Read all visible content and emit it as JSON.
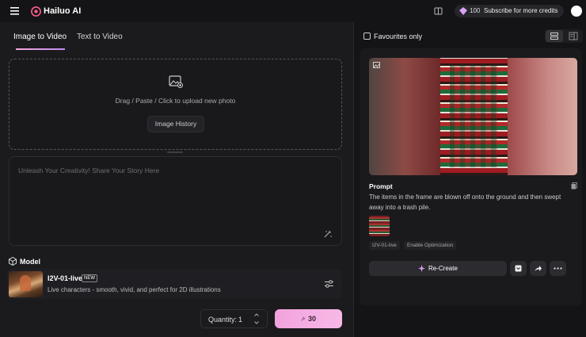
{
  "header": {
    "brand": "Hailuo AI",
    "credits": "100",
    "subscribe": "Subscribe for more credits"
  },
  "tabs": [
    {
      "label": "Image to Video",
      "active": true
    },
    {
      "label": "Text to Video",
      "active": false
    }
  ],
  "upload": {
    "text": "Drag / Paste / Click to upload new photo",
    "history_button": "Image History"
  },
  "prompt": {
    "placeholder": "Unleash Your Creativity! Share Your Story Here"
  },
  "model": {
    "section_label": "Model",
    "name": "I2V-01-live",
    "badge": "NEW",
    "description": "Live characters - smooth, vivid, and perfect for 2D illustrations"
  },
  "quantity": {
    "label": "Quantity:",
    "value": "1"
  },
  "generate": {
    "cost": "30"
  },
  "right": {
    "favourites_label": "Favourites only",
    "prompt_title": "Prompt",
    "prompt_text": "The items in the frame are blown off onto the ground and then swept away into a trash pile.",
    "tags": [
      "I2V-01-live",
      "Enable Optimization"
    ],
    "recreate_label": "Re-Create"
  },
  "colors": {
    "accent_pink": "#f4a6d9",
    "bg": "#141416",
    "panel": "#1b1b1e"
  }
}
